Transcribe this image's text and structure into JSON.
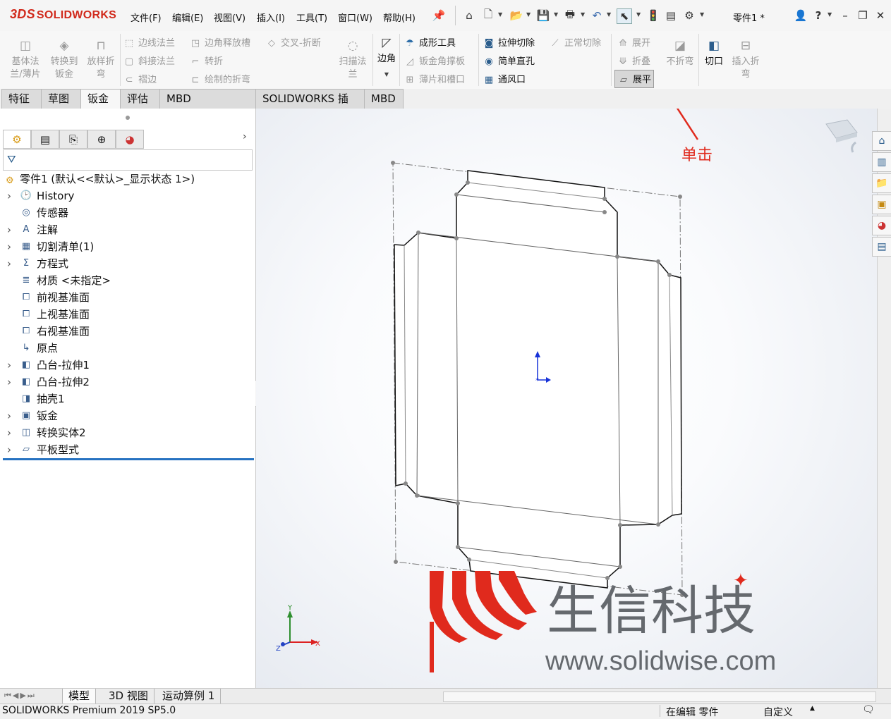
{
  "app": {
    "logo_text": "SOLIDWORKS",
    "logo_mark": "3DS",
    "document_title": "零件1 *"
  },
  "menu": [
    "文件(F)",
    "编辑(E)",
    "视图(V)",
    "插入(I)",
    "工具(T)",
    "窗口(W)",
    "帮助(H)"
  ],
  "quick_access": [
    "home-icon",
    "new-document-icon",
    "open-icon",
    "save-icon",
    "print-icon",
    "undo-icon",
    "select-cursor-icon",
    "rebuild-icon",
    "file-properties-icon",
    "options-gear-icon"
  ],
  "ribbon": {
    "base_flange": "基体法\n兰/薄片",
    "convert_to_sheet_metal": "转换到\n钣金",
    "lofted_bend": "放样折\n弯",
    "edge_flange": "边线法兰",
    "miter_flange": "斜接法兰",
    "hem": "褶边",
    "corner_relief": "边角释放槽",
    "jog": "转折",
    "sketched_bend": "绘制的折弯",
    "cross_break": "交叉-折断",
    "swept_flange": "扫描法\n兰",
    "corners": "边角",
    "forming_tool": "成形工具",
    "sheet_metal_gusset": "钣金角撑板",
    "tab_and_slot": "薄片和槽口",
    "extruded_cut": "拉伸切除",
    "simple_hole": "简单直孔",
    "vent": "通风口",
    "normal_cut": "正常切除",
    "unfold": "展开",
    "fold": "折叠",
    "flatten": "展平",
    "no_bends": "不折弯",
    "rip": "切口",
    "insert_bends": "插入折\n弯"
  },
  "tabs": [
    "特征",
    "草图",
    "钣金",
    "评估",
    "MBD Dimensions",
    "SOLIDWORKS 插件",
    "MBD"
  ],
  "active_tab": "钣金",
  "tree": {
    "root": "零件1  (默认<<默认>_显示状态 1>)",
    "items": [
      {
        "label": "History",
        "expandable": true,
        "icon": "history-folder-icon"
      },
      {
        "label": "传感器",
        "expandable": false,
        "icon": "sensor-icon"
      },
      {
        "label": "注解",
        "expandable": true,
        "icon": "annotation-icon"
      },
      {
        "label": "切割清单(1)",
        "expandable": true,
        "icon": "cut-list-icon"
      },
      {
        "label": "方程式",
        "expandable": true,
        "icon": "equation-icon"
      },
      {
        "label": "材质 <未指定>",
        "expandable": false,
        "icon": "material-icon"
      },
      {
        "label": "前视基准面",
        "expandable": false,
        "icon": "plane-icon"
      },
      {
        "label": "上视基准面",
        "expandable": false,
        "icon": "plane-icon"
      },
      {
        "label": "右视基准面",
        "expandable": false,
        "icon": "plane-icon"
      },
      {
        "label": "原点",
        "expandable": false,
        "icon": "origin-icon"
      },
      {
        "label": "凸台-拉伸1",
        "expandable": true,
        "icon": "boss-extrude-icon"
      },
      {
        "label": "凸台-拉伸2",
        "expandable": true,
        "icon": "boss-extrude-icon"
      },
      {
        "label": "抽壳1",
        "expandable": false,
        "icon": "shell-icon"
      },
      {
        "label": "钣金",
        "expandable": true,
        "icon": "sheet-metal-icon"
      },
      {
        "label": "转换实体2",
        "expandable": true,
        "icon": "convert-entities-icon"
      },
      {
        "label": "平板型式",
        "expandable": true,
        "icon": "flat-pattern-icon"
      }
    ]
  },
  "annotation": {
    "text": "单击",
    "color": "#e02a1d"
  },
  "triad": {
    "x": "X",
    "y": "Y",
    "z": "Z"
  },
  "watermark": {
    "title": "生信科技",
    "url": "www.solidwise.com",
    "logo_color": "#e02a1d"
  },
  "bottom_tabs": [
    "模型",
    "3D 视图",
    "运动算例 1"
  ],
  "status": {
    "product": "SOLIDWORKS Premium 2019 SP5.0",
    "mode": "在编辑 零件",
    "units": "自定义"
  }
}
